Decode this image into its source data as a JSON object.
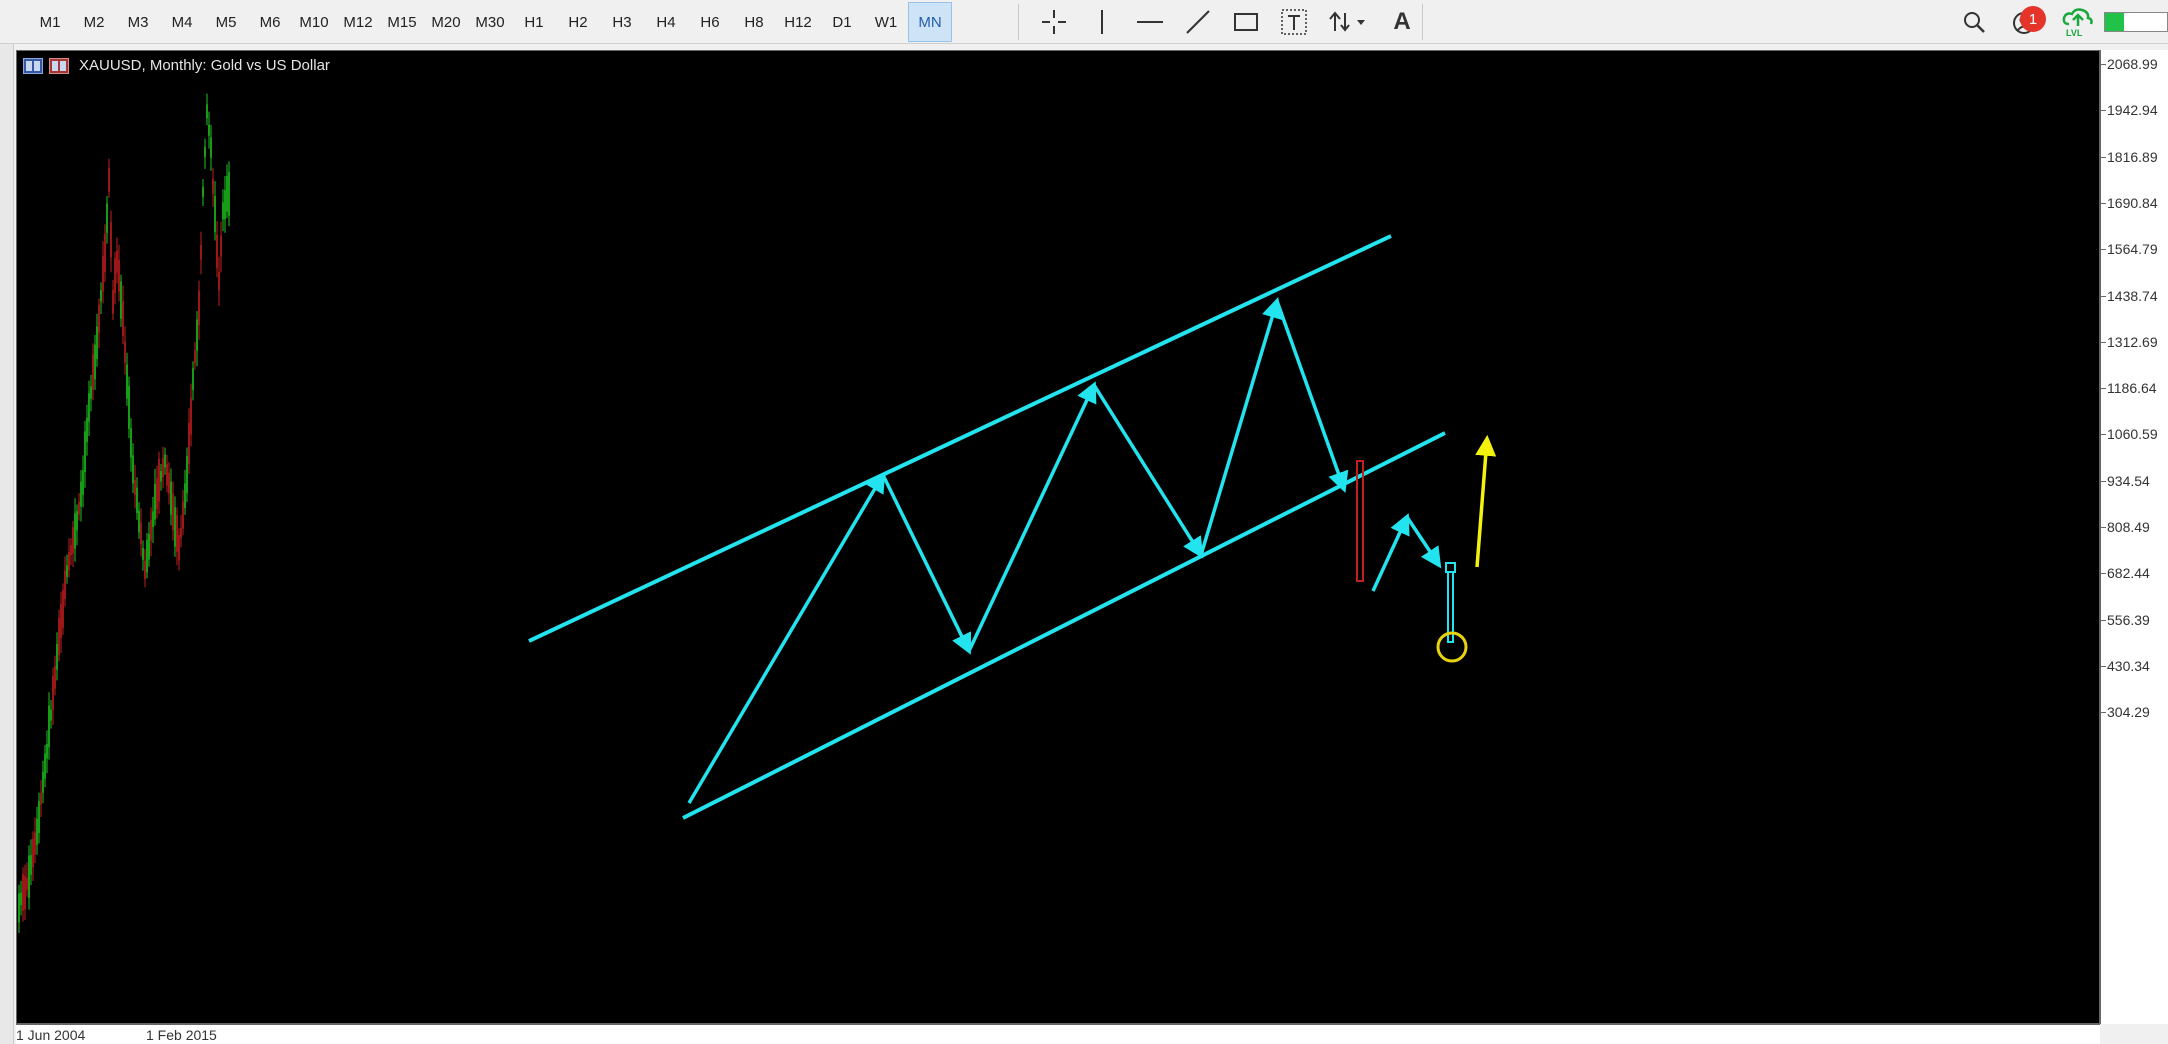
{
  "toolbar": {
    "timeframes": [
      {
        "label": "M1",
        "active": false
      },
      {
        "label": "M2",
        "active": false
      },
      {
        "label": "M3",
        "active": false
      },
      {
        "label": "M4",
        "active": false
      },
      {
        "label": "M5",
        "active": false
      },
      {
        "label": "M6",
        "active": false
      },
      {
        "label": "M10",
        "active": false
      },
      {
        "label": "M12",
        "active": false
      },
      {
        "label": "M15",
        "active": false
      },
      {
        "label": "M20",
        "active": false
      },
      {
        "label": "M30",
        "active": false
      },
      {
        "label": "H1",
        "active": false
      },
      {
        "label": "H2",
        "active": false
      },
      {
        "label": "H3",
        "active": false
      },
      {
        "label": "H4",
        "active": false
      },
      {
        "label": "H6",
        "active": false
      },
      {
        "label": "H8",
        "active": false
      },
      {
        "label": "H12",
        "active": false
      },
      {
        "label": "D1",
        "active": false
      },
      {
        "label": "W1",
        "active": false
      },
      {
        "label": "MN",
        "active": true
      }
    ],
    "tools": [
      "crosshair-icon",
      "vertical-line-icon",
      "horizontal-line-icon",
      "trendline-icon",
      "rectangle-icon",
      "text-icon",
      "arrows-icon",
      "text-label-icon"
    ],
    "text_label_glyph": "A",
    "notification_count": "1",
    "connection_level": 0.3,
    "colors": {
      "active_tf_bg": "#cfe3f7",
      "badge": "#e5352b",
      "connection": "#22c24a"
    }
  },
  "chart": {
    "title": "XAUUSD, Monthly:  Gold vs US Dollar",
    "price_labels": [
      "2068.99",
      "1942.94",
      "1816.89",
      "1690.84",
      "1564.79",
      "1438.74",
      "1312.69",
      "1186.64",
      "1060.59",
      "934.54",
      "808.49",
      "682.44",
      "556.39",
      "430.34",
      "304.29"
    ],
    "time_labels": [
      "1 Jun 2004",
      "1 Feb 2015"
    ],
    "colors": {
      "background": "#000000",
      "channel": "#22e3ee",
      "bull_candle": "#1fc21f",
      "bear_candle": "#c21f1f",
      "target_arrow": "#f2f20e",
      "circle": "#e8d40e",
      "box": "#c21f1f"
    }
  }
}
